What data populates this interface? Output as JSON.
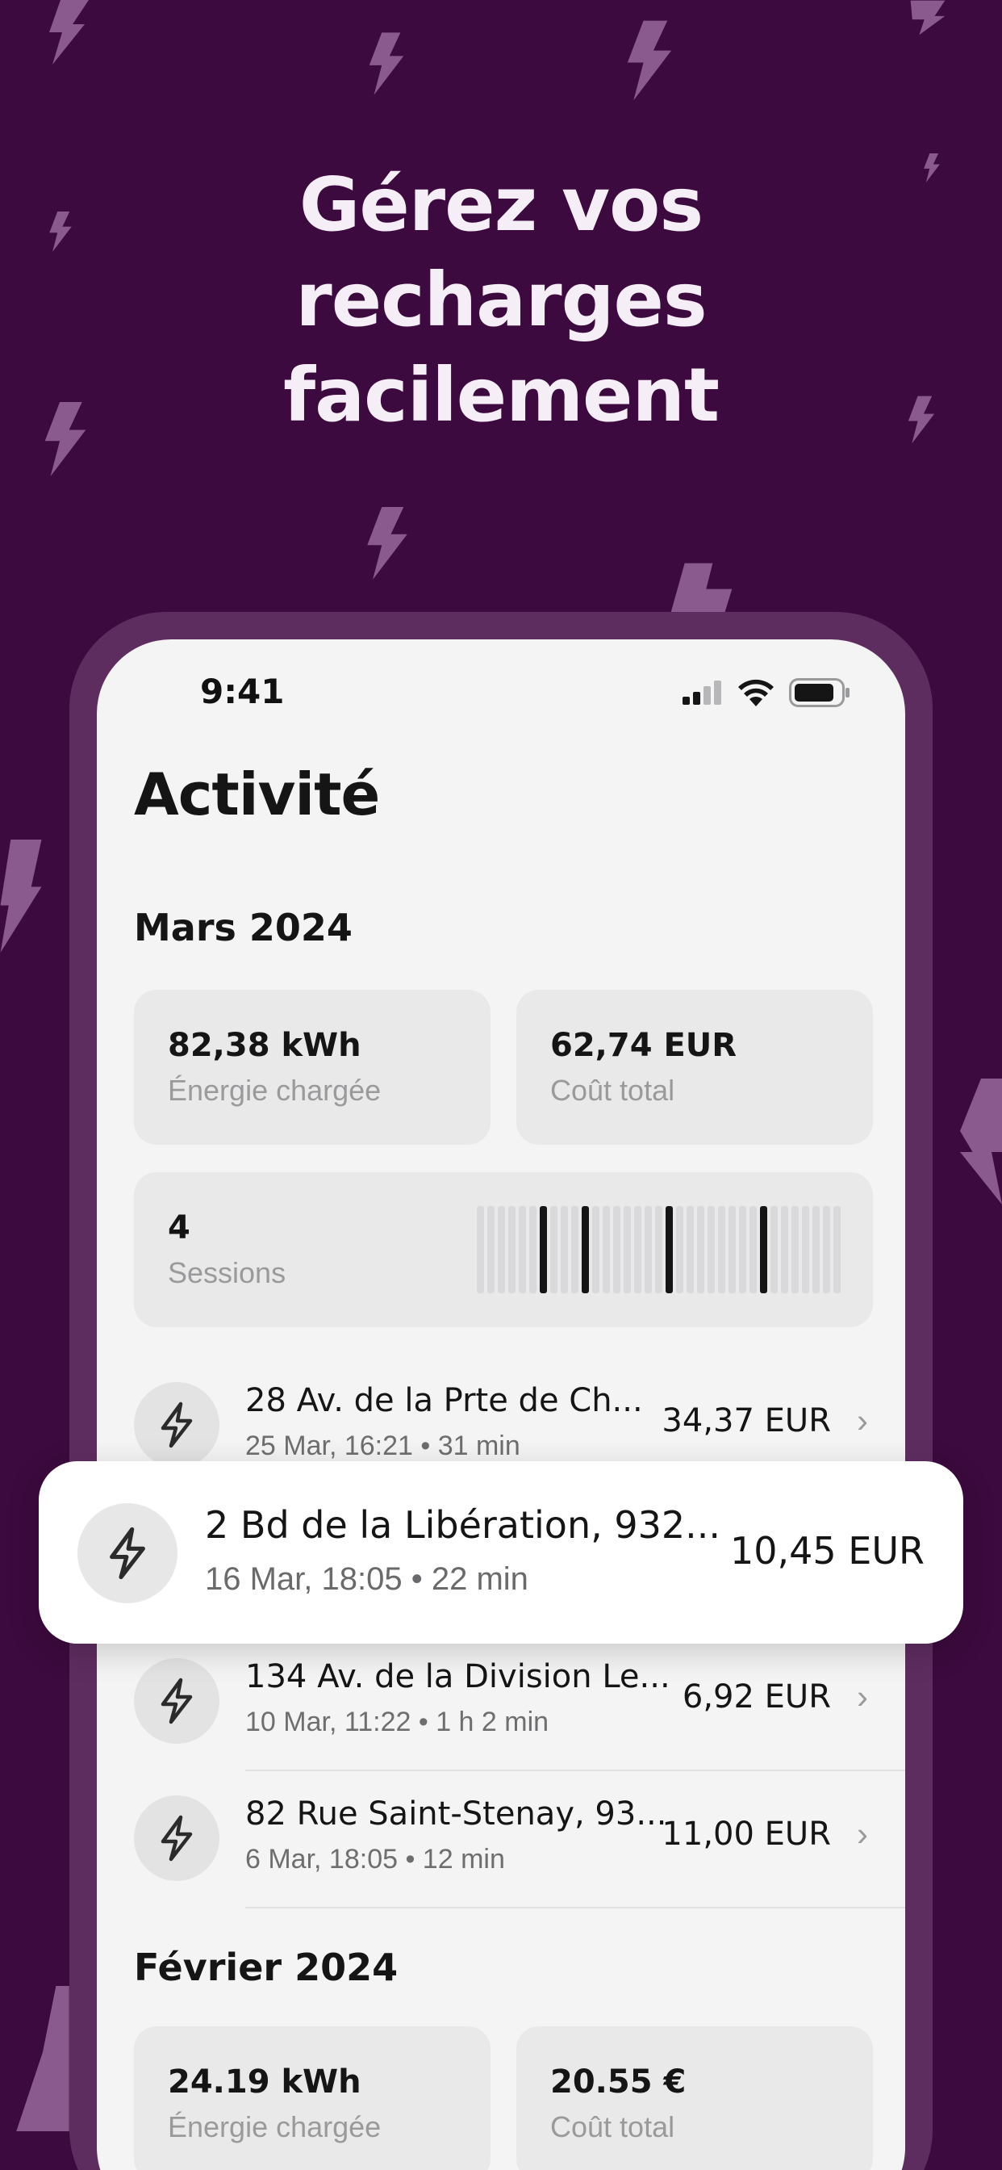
{
  "headline": [
    "Gérez vos",
    "recharges",
    "facilement"
  ],
  "status_bar": {
    "time": "9:41"
  },
  "page_title": "Activité",
  "months": [
    {
      "title": "Mars 2024",
      "energy_value": "82,38 kWh",
      "energy_label": "Énergie chargée",
      "cost_value": "62,74 EUR",
      "cost_label": "Coût total",
      "sessions_value": "4",
      "sessions_label": "Sessions"
    },
    {
      "title": "Février 2024",
      "energy_value": "24.19 kWh",
      "energy_label": "Énergie chargée",
      "cost_value": "20.55 €",
      "cost_label": "Coût total"
    }
  ],
  "sessions": [
    {
      "title": "28 Av. de la Prte de Ch...",
      "subtitle": "25 Mar, 16:21 • 31 min",
      "price": "34,37 EUR"
    },
    {
      "title": "2 Bd de la Libération, 932...",
      "subtitle": "16 Mar, 18:05 • 22 min",
      "price": "10,45 EUR"
    },
    {
      "title": "134 Av. de la Division Le...",
      "subtitle": "10 Mar, 11:22 • 1 h 2 min",
      "price": "6,92 EUR"
    },
    {
      "title": "82 Rue Saint-Stenay, 93...",
      "subtitle": "6 Mar, 18:05 • 12 min",
      "price": "11,00 EUR"
    }
  ],
  "icons": {
    "session": "lightning-icon",
    "chevron": "chevron-right-icon",
    "signal": "signal-icon",
    "wifi": "wifi-icon",
    "battery": "battery-icon"
  },
  "colors": {
    "background": "#3c0a3e",
    "frame": "#5e2d60",
    "screen": "#f4f4f4",
    "accent_bolt": "#8a5a8f"
  }
}
